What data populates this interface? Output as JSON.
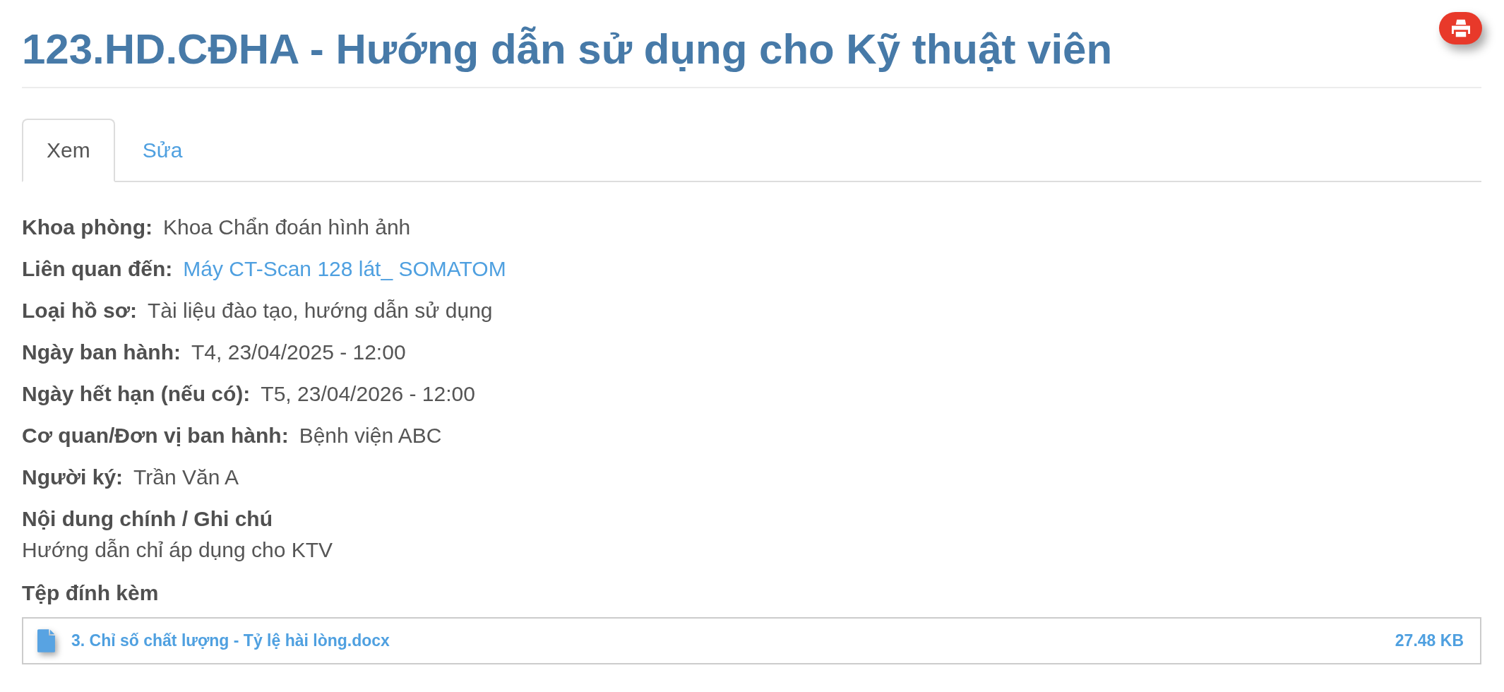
{
  "title": "123.HD.CĐHA - Hướng dẫn sử dụng cho Kỹ thuật viên",
  "tabs": [
    {
      "label": "Xem",
      "selected": true
    },
    {
      "label": "Sửa",
      "selected": false
    }
  ],
  "fields": [
    {
      "label": "Khoa phòng:",
      "value": "Khoa Chẩn đoán hình ảnh",
      "kind": "text"
    },
    {
      "label": "Liên quan đến:",
      "value": "Máy CT-Scan 128 lát_ SOMATOM",
      "kind": "link"
    },
    {
      "label": "Loại hồ sơ:",
      "value": "Tài liệu đào tạo, hướng dẫn sử dụng",
      "kind": "text"
    },
    {
      "label": "Ngày ban hành:",
      "value": "T4, 23/04/2025 - 12:00",
      "kind": "text"
    },
    {
      "label": "Ngày hết hạn (nếu có):",
      "value": "T5, 23/04/2026 - 12:00",
      "kind": "text"
    },
    {
      "label": "Cơ quan/Đơn vị ban hành:",
      "value": "Bệnh viện ABC",
      "kind": "text"
    },
    {
      "label": "Người ký:",
      "value": "Trần Văn A",
      "kind": "text"
    }
  ],
  "notes": {
    "heading": "Nội dung chính / Ghi chú",
    "text": "Hướng dẫn chỉ áp dụng cho KTV"
  },
  "attachments": {
    "heading": "Tệp đính kèm",
    "files": [
      {
        "name": "3. Chỉ số chất lượng - Tỷ lệ hài lòng.docx",
        "size": "27.48 KB"
      }
    ]
  }
}
